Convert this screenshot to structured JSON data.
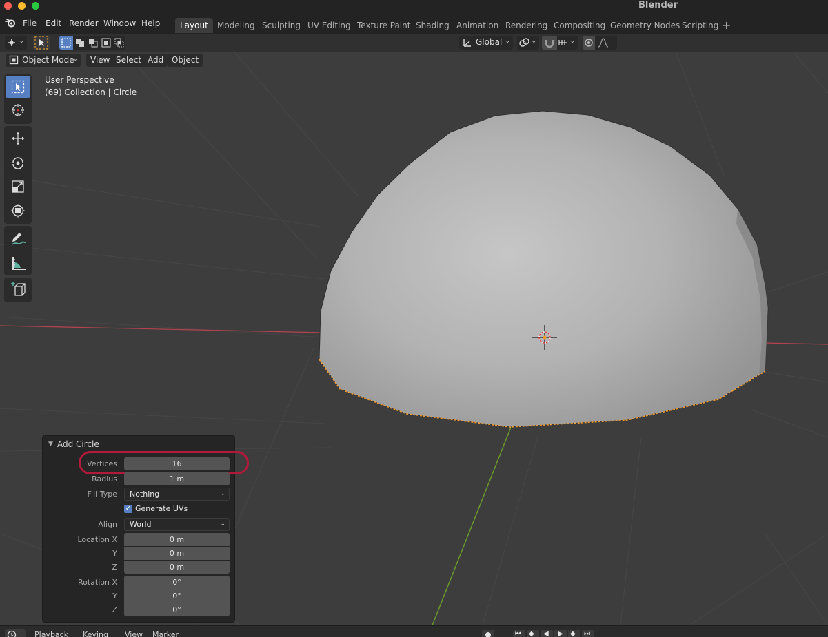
{
  "window": {
    "title": "Blender"
  },
  "menu": {
    "items": [
      "File",
      "Edit",
      "Render",
      "Window",
      "Help"
    ]
  },
  "workspaces": {
    "active": "Layout",
    "tabs": [
      "Layout",
      "Modeling",
      "Sculpting",
      "UV Editing",
      "Texture Paint",
      "Shading",
      "Animation",
      "Rendering",
      "Compositing",
      "Geometry Nodes",
      "Scripting"
    ],
    "add_label": "+"
  },
  "header": {
    "transform_orientation": "Global"
  },
  "viewport_header": {
    "mode": "Object Mode",
    "menus": [
      "View",
      "Select",
      "Add",
      "Object"
    ]
  },
  "overlay": {
    "perspective": "User Perspective",
    "collection": "(69) Collection | Circle"
  },
  "toolbar": {
    "tools": [
      "select-box-icon",
      "cursor-icon",
      "move-icon",
      "rotate-icon",
      "scale-icon",
      "transform-icon",
      "annotate-icon",
      "measure-icon",
      "add-cube-icon"
    ],
    "active_tool": "select-box-icon"
  },
  "operator": {
    "title": "Add Circle",
    "vertices_label": "Vertices",
    "vertices": "16",
    "radius_label": "Radius",
    "radius": "1 m",
    "fill_type_label": "Fill Type",
    "fill_type": "Nothing",
    "generate_uvs_label": "Generate UVs",
    "generate_uvs": true,
    "align_label": "Align",
    "align": "World",
    "location_x_label": "Location X",
    "location_y_label": "Y",
    "location_z_label": "Z",
    "location": [
      "0 m",
      "0 m",
      "0 m"
    ],
    "rotation_x_label": "Rotation X",
    "rotation_y_label": "Y",
    "rotation_z_label": "Z",
    "rotation": [
      "0°",
      "0°",
      "0°"
    ]
  },
  "timeline": {
    "menus": [
      "Playback",
      "Keying",
      "View",
      "Marker"
    ]
  },
  "colors": {
    "accent": "#5680c2",
    "highlight_ring": "#b11a3b",
    "selection_outline": "#f29a2e",
    "x_axis": "#b5434f",
    "y_axis": "#6b9a2c"
  }
}
